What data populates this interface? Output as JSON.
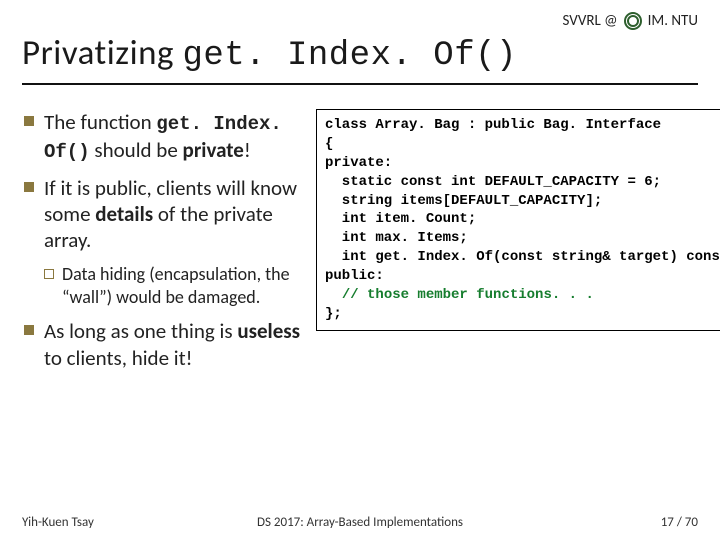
{
  "header": {
    "label_left": "SVVRL @",
    "label_right": "IM. NTU"
  },
  "title": {
    "prefix": "Privatizing ",
    "code": "get. Index. Of()"
  },
  "bullets": [
    {
      "level": 1,
      "parts": [
        "The function ",
        "get. Index. Of()",
        " should be ",
        "private",
        "!"
      ],
      "mono": [
        false,
        true,
        false,
        false,
        false
      ],
      "bold": [
        false,
        true,
        false,
        true,
        false
      ]
    },
    {
      "level": 1,
      "parts": [
        "If it is public, clients will know some ",
        "details",
        " of the private array."
      ],
      "bold": [
        false,
        true,
        false
      ]
    },
    {
      "level": 2,
      "parts": [
        "Data hiding (encapsulation, the “wall”) would be damaged."
      ]
    },
    {
      "level": 1,
      "parts": [
        "As long as one thing is ",
        "useless",
        " to clients, hide it!"
      ],
      "bold": [
        false,
        true,
        false
      ]
    }
  ],
  "code": {
    "lines": [
      "class Array. Bag : public Bag. Interface",
      "{",
      "private:",
      "  static const int DEFAULT_CAPACITY = 6;",
      "  string items[DEFAULT_CAPACITY];",
      "  int item. Count;",
      "  int max. Items;",
      "  int get. Index. Of(const string& target) const;",
      "public:",
      "  // those member functions. . .",
      "};"
    ],
    "comment_prefix": "//"
  },
  "footer": {
    "left": "Yih-Kuen Tsay",
    "center": "DS 2017: Array-Based Implementations",
    "right": "17 / 70"
  }
}
